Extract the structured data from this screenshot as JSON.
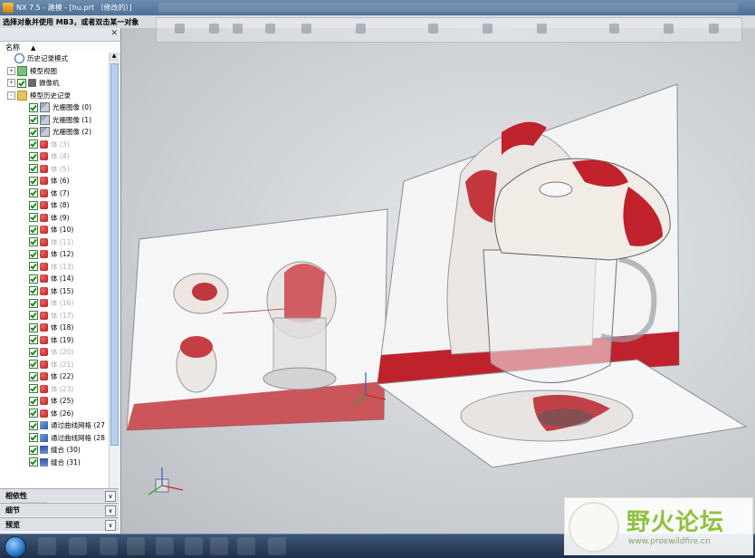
{
  "titlebar": {
    "app_title": "NX 7.5 - 建模 - [hu.prt （修改的）]"
  },
  "status": {
    "prompt": "选择对象并使用 MB3，或者双击某一对象"
  },
  "navigator": {
    "column_header": "名称",
    "items": [
      {
        "label": "历史记录模式",
        "icon": "clock-icon",
        "indent": 1,
        "check": false,
        "expand": "",
        "dim": false
      },
      {
        "label": "模型视图",
        "icon": "model-view-icon",
        "indent": 0,
        "check": false,
        "expand": "+",
        "dim": false
      },
      {
        "label": "摄像机",
        "icon": "camera-icon",
        "indent": 0,
        "check": true,
        "expand": "+",
        "dim": false
      },
      {
        "label": "模型历史记录",
        "icon": "folder-icon",
        "indent": 0,
        "check": false,
        "expand": "-",
        "dim": false
      },
      {
        "label": "光栅图像 (0)",
        "icon": "raster-image-icon",
        "indent": 2,
        "check": true,
        "dim": false
      },
      {
        "label": "光栅图像 (1)",
        "icon": "raster-image-icon",
        "indent": 2,
        "check": true,
        "dim": false
      },
      {
        "label": "光栅图像 (2)",
        "icon": "raster-image-icon",
        "indent": 2,
        "check": true,
        "dim": false
      },
      {
        "label": "体 (3)",
        "icon": "body-icon",
        "indent": 2,
        "check": true,
        "dim": true
      },
      {
        "label": "体 (4)",
        "icon": "body-icon",
        "indent": 2,
        "check": true,
        "dim": true
      },
      {
        "label": "体 (5)",
        "icon": "body-icon",
        "indent": 2,
        "check": true,
        "dim": true
      },
      {
        "label": "体 (6)",
        "icon": "body-icon",
        "indent": 2,
        "check": true,
        "dim": false
      },
      {
        "label": "体 (7)",
        "icon": "body-icon",
        "indent": 2,
        "check": true,
        "dim": false
      },
      {
        "label": "体 (8)",
        "icon": "body-icon",
        "indent": 2,
        "check": true,
        "dim": false
      },
      {
        "label": "体 (9)",
        "icon": "body-icon",
        "indent": 2,
        "check": true,
        "dim": false
      },
      {
        "label": "体 (10)",
        "icon": "body-icon",
        "indent": 2,
        "check": true,
        "dim": false
      },
      {
        "label": "体 (11)",
        "icon": "body-icon",
        "indent": 2,
        "check": true,
        "dim": true
      },
      {
        "label": "体 (12)",
        "icon": "body-icon",
        "indent": 2,
        "check": true,
        "dim": false
      },
      {
        "label": "体 (13)",
        "icon": "body-icon",
        "indent": 2,
        "check": true,
        "dim": true
      },
      {
        "label": "体 (14)",
        "icon": "body-icon",
        "indent": 2,
        "check": true,
        "dim": false
      },
      {
        "label": "体 (15)",
        "icon": "body-icon",
        "indent": 2,
        "check": true,
        "dim": false
      },
      {
        "label": "体 (16)",
        "icon": "body-icon",
        "indent": 2,
        "check": true,
        "dim": true
      },
      {
        "label": "体 (17)",
        "icon": "body-icon",
        "indent": 2,
        "check": true,
        "dim": true
      },
      {
        "label": "体 (18)",
        "icon": "body-icon",
        "indent": 2,
        "check": true,
        "dim": false
      },
      {
        "label": "体 (19)",
        "icon": "body-icon",
        "indent": 2,
        "check": true,
        "dim": false
      },
      {
        "label": "体 (20)",
        "icon": "body-icon",
        "indent": 2,
        "check": true,
        "dim": true
      },
      {
        "label": "体 (21)",
        "icon": "body-icon",
        "indent": 2,
        "check": true,
        "dim": true
      },
      {
        "label": "体 (22)",
        "icon": "body-icon",
        "indent": 2,
        "check": true,
        "dim": false
      },
      {
        "label": "体 (23)",
        "icon": "body-icon",
        "indent": 2,
        "check": true,
        "dim": true
      },
      {
        "label": "体 (25)",
        "icon": "body-icon",
        "indent": 2,
        "check": true,
        "dim": false
      },
      {
        "label": "体 (26)",
        "icon": "body-icon",
        "indent": 2,
        "check": true,
        "dim": false
      },
      {
        "label": "通过曲线网格 (27",
        "icon": "mesh-icon",
        "indent": 2,
        "check": true,
        "dim": false
      },
      {
        "label": "通过曲线网格 (28",
        "icon": "mesh-icon",
        "indent": 2,
        "check": true,
        "dim": false
      },
      {
        "label": "缝合 (30)",
        "icon": "sew-icon",
        "indent": 2,
        "check": true,
        "dim": false
      },
      {
        "label": "缝合 (31)",
        "icon": "sew-icon",
        "indent": 2,
        "check": true,
        "dim": false
      }
    ],
    "sections": [
      "相依性",
      "细节",
      "预览"
    ]
  },
  "watermark": {
    "title": "野火论坛",
    "url": "www.proewildfire.cn"
  },
  "colors": {
    "accent_red": "#c0222b",
    "titlebar": "#4d6f96",
    "taskbar": "#1f3049"
  }
}
